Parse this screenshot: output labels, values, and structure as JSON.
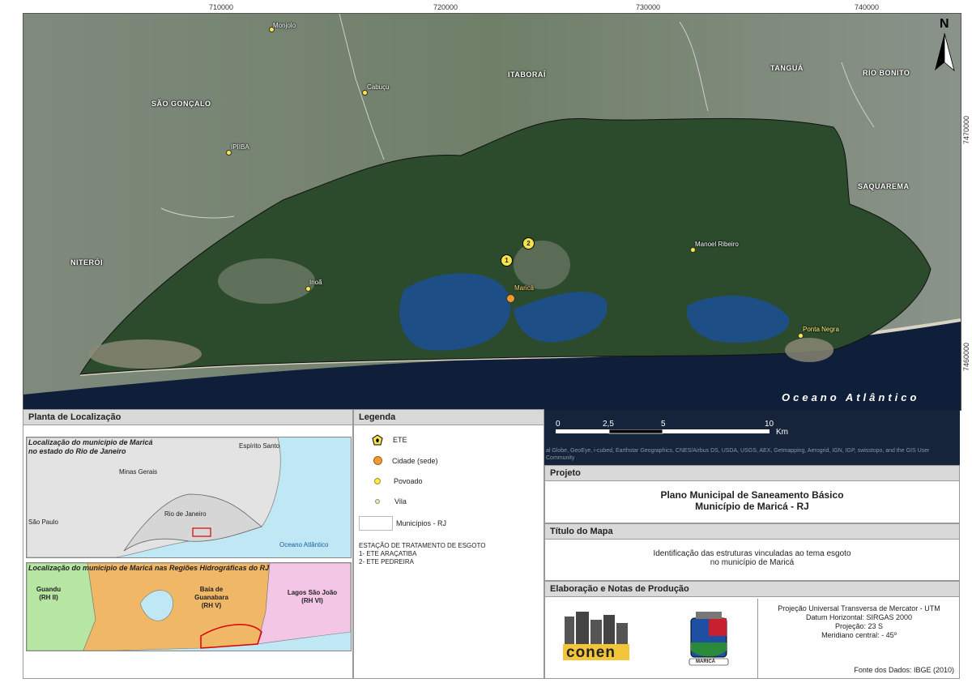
{
  "map": {
    "top_coords": [
      "710000",
      "720000",
      "730000",
      "740000"
    ],
    "right_coords": [
      "7470000",
      "7460000"
    ],
    "north_label": "N",
    "ocean_label": "Oceano Atlântico",
    "municipalities": [
      "SÃO GONÇALO",
      "ITABORAÍ",
      "TANGUÁ",
      "RIO BONITO",
      "SAQUAREMA",
      "NITERÓI"
    ],
    "places": {
      "monjolo": "Monjolo",
      "cabucu": "Cabuçu",
      "ipiiba": "IPIIBA",
      "inoa": "Inoã",
      "marica": "Maricá",
      "manoel": "Manoel Ribeiro",
      "ponta": "Ponta Negra"
    },
    "ete_numbers": [
      "1",
      "2"
    ],
    "scale": {
      "ticks": [
        "0",
        "2,5",
        "5",
        "10"
      ],
      "unit": "Km"
    },
    "attribution": "al Globe, GeoEye, i-cubed, Earthstar Geographics, CNES/Airbus DS, USDA, USGS, AEX, Getmapping, Aerogrid, IGN, IGP, swisstopo, and the GIS User Community"
  },
  "location": {
    "title": "Planta de Localização",
    "state_caption": "Localização do município de Maricá\nno estado do Rio de Janeiro",
    "states": [
      "Espírito Santo",
      "Minas Gerais",
      "Rio de Janeiro",
      "São Paulo"
    ],
    "ocean": "Oceano Atlântico",
    "regions_caption": "Localização do município de Maricá nas Regiões Hidrográficas do  RJ",
    "regions": {
      "guandu": "Guandu\n(RH II)",
      "guanabara": "Baía de\nGuanabara\n(RH V)",
      "lagos": "Lagos São João\n(RH VI)"
    }
  },
  "legend": {
    "title": "Legenda",
    "items": [
      "ETE",
      "Cidade (sede)",
      "Povoado",
      "Vila",
      "Municípios - RJ"
    ],
    "ete_title": "ESTAÇÃO DE TRATAMENTO DE ESGOTO",
    "ete_items": [
      "1- ETE ARAÇATIBA",
      "2- ETE PEDREIRA"
    ]
  },
  "project": {
    "heading": "Projeto",
    "line1": "Plano Municipal de Saneamento Básico",
    "line2": "Município de Maricá - RJ"
  },
  "map_title": {
    "heading": "Título do Mapa",
    "line1": "Identificação das estruturas vinculadas ao tema esgoto",
    "line2": "no município de Maricá"
  },
  "production": {
    "heading": "Elaboração e Notas de Produção",
    "logo_text": "conen",
    "seal_text": "MARICÁ",
    "notes": [
      "Projeção Universal Transversa de Mercator - UTM",
      "Datum Horizontal: SIRGAS 2000",
      "Projeção: 23 S",
      "Meridiano central: - 45º"
    ],
    "source": "Fonte dos Dados: IBGE (2010)"
  },
  "colors": {
    "ocean": "#0f1f3a",
    "lagoon": "#1d4f86",
    "forest": "#2c4a2c",
    "urban": "#8a8f86",
    "region_orange": "#f0b866",
    "region_green": "#b7e6a3",
    "region_pink": "#f3c6e6",
    "sea_blue": "#bfe8f4"
  }
}
